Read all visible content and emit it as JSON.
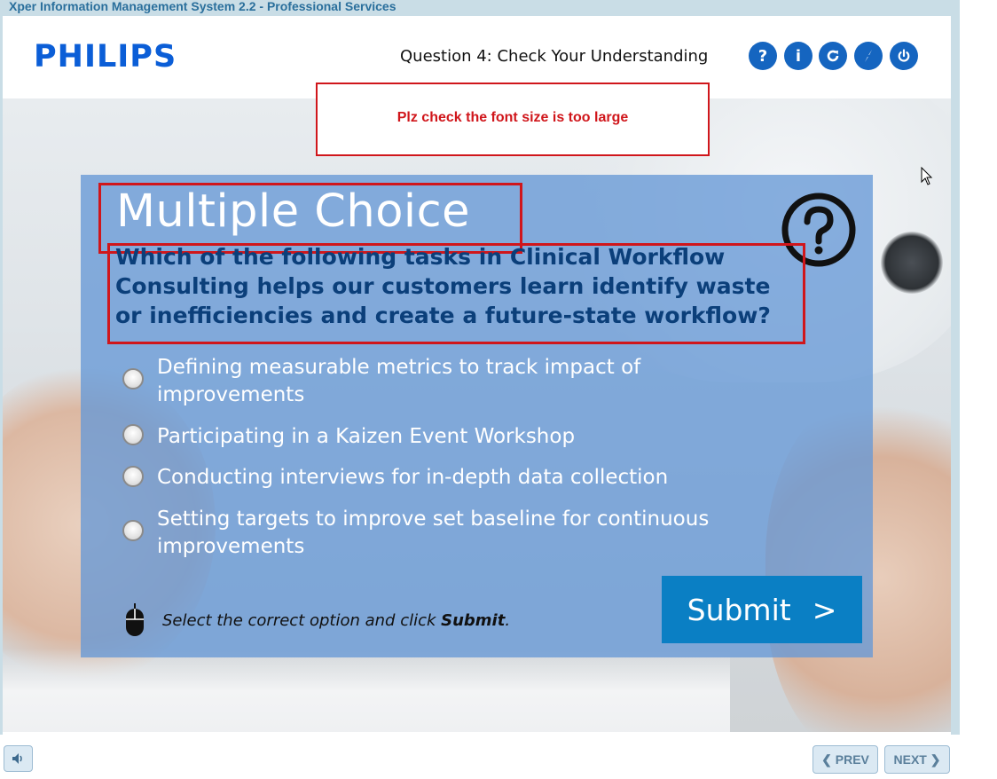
{
  "app": {
    "title": "Xper Information Management System 2.2 - Professional Services"
  },
  "header": {
    "logo": "PHILIPS",
    "title": "Question 4: Check Your Understanding",
    "buttons": [
      {
        "name": "help-button",
        "label": "?"
      },
      {
        "name": "info-button",
        "label": "i"
      },
      {
        "name": "replay-button",
        "icon": "refresh-icon"
      },
      {
        "name": "glossary-button",
        "icon": "compass-icon"
      },
      {
        "name": "exit-button",
        "icon": "power-icon"
      }
    ],
    "accent": "#1565c0"
  },
  "review_note": {
    "text": "Plz check the font size is too large",
    "color": "#d0161b"
  },
  "quiz": {
    "heading": "Multiple Choice",
    "question": "Which of the following tasks in Clinical Workflow Consulting helps our customers learn identify waste or inefficiencies and create a future-state workflow?",
    "options": [
      "Defining measurable metrics to track impact of improvements",
      "Participating in a Kaizen Event Workshop",
      "Conducting interviews for in-depth data collection",
      "Setting targets to improve set baseline for continuous improvements"
    ],
    "instruction_prefix": "Select the correct option and click ",
    "instruction_bold": "Submit",
    "instruction_suffix": ".",
    "submit_label": "Submit",
    "submit_arrow": ">"
  },
  "footer": {
    "prev_label": "PREV",
    "next_label": "NEXT"
  }
}
